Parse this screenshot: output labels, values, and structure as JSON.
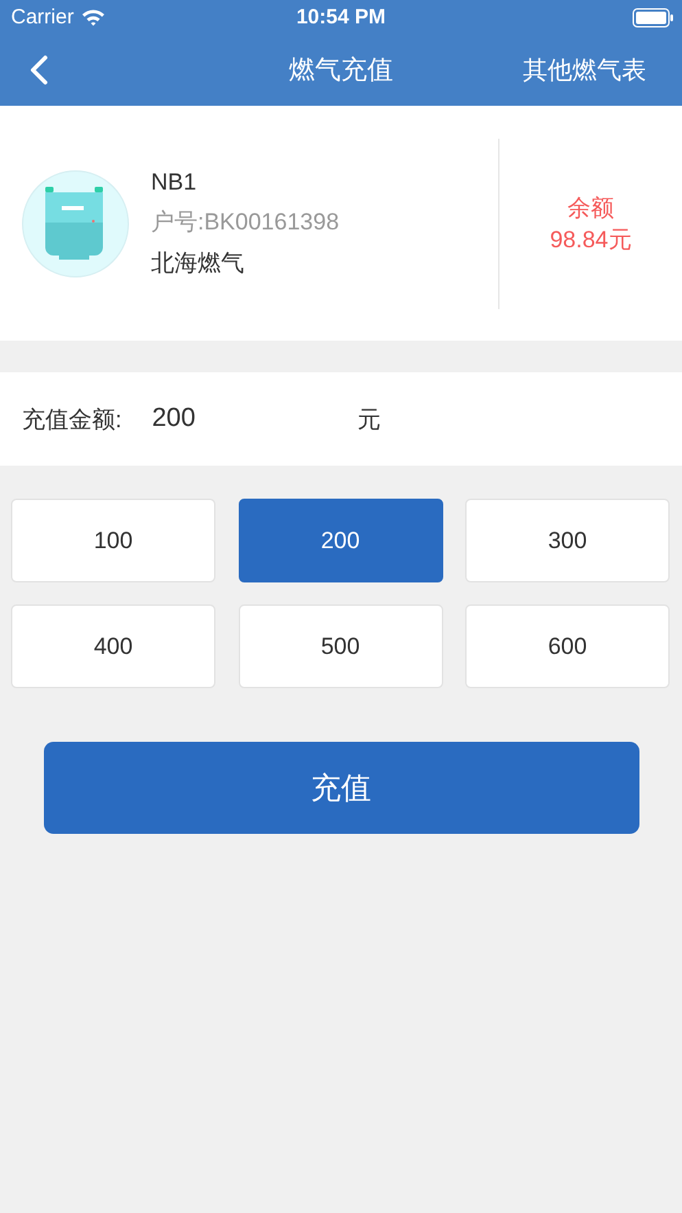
{
  "status_bar": {
    "carrier": "Carrier",
    "time": "10:54 PM"
  },
  "nav": {
    "title": "燃气充值",
    "action": "其他燃气表"
  },
  "meter": {
    "name": "NB1",
    "account": "户号:BK00161398",
    "company": "北海燃气",
    "balance_label": "余额",
    "balance": "98.84元"
  },
  "amount": {
    "label": "充值金额:",
    "value": "200",
    "unit": "元"
  },
  "options": [
    {
      "label": "100",
      "selected": false
    },
    {
      "label": "200",
      "selected": true
    },
    {
      "label": "300",
      "selected": false
    },
    {
      "label": "400",
      "selected": false
    },
    {
      "label": "500",
      "selected": false
    },
    {
      "label": "600",
      "selected": false
    }
  ],
  "submit": "充值"
}
